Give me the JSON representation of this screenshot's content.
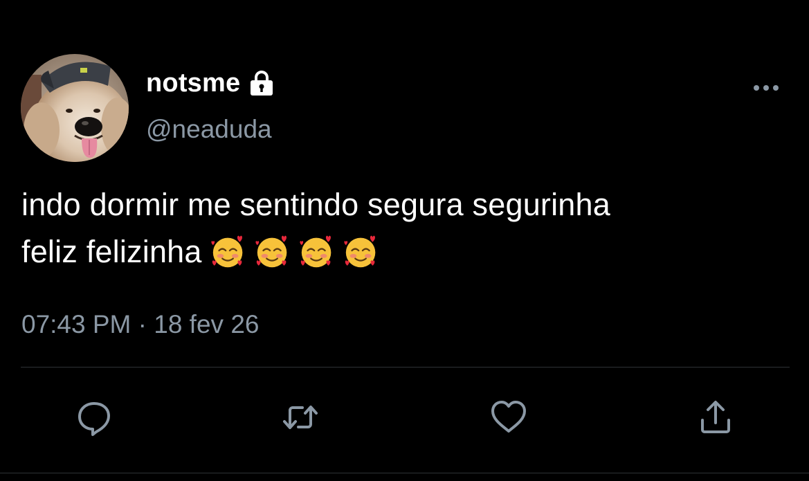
{
  "tweet": {
    "display_name": "notsme",
    "handle": "@neaduda",
    "text_line1": "indo dormir me sentindo segura segurinha",
    "text_line2": "feliz felizinha",
    "emojis": [
      "smiling-face-with-hearts",
      "smiling-face-with-hearts",
      "smiling-face-with-hearts",
      "smiling-face-with-hearts"
    ],
    "timestamp": "07:43 PM · 18 fev 26",
    "protected_icon": "lock-icon",
    "avatar": "dog-wearing-cap"
  },
  "actions": {
    "reply": "reply-icon",
    "retweet": "retweet-icon",
    "like": "heart-icon",
    "share": "share-icon"
  },
  "colors": {
    "background": "#000000",
    "text": "#ffffff",
    "secondary": "#8b98a5",
    "divider": "#2f3336"
  }
}
